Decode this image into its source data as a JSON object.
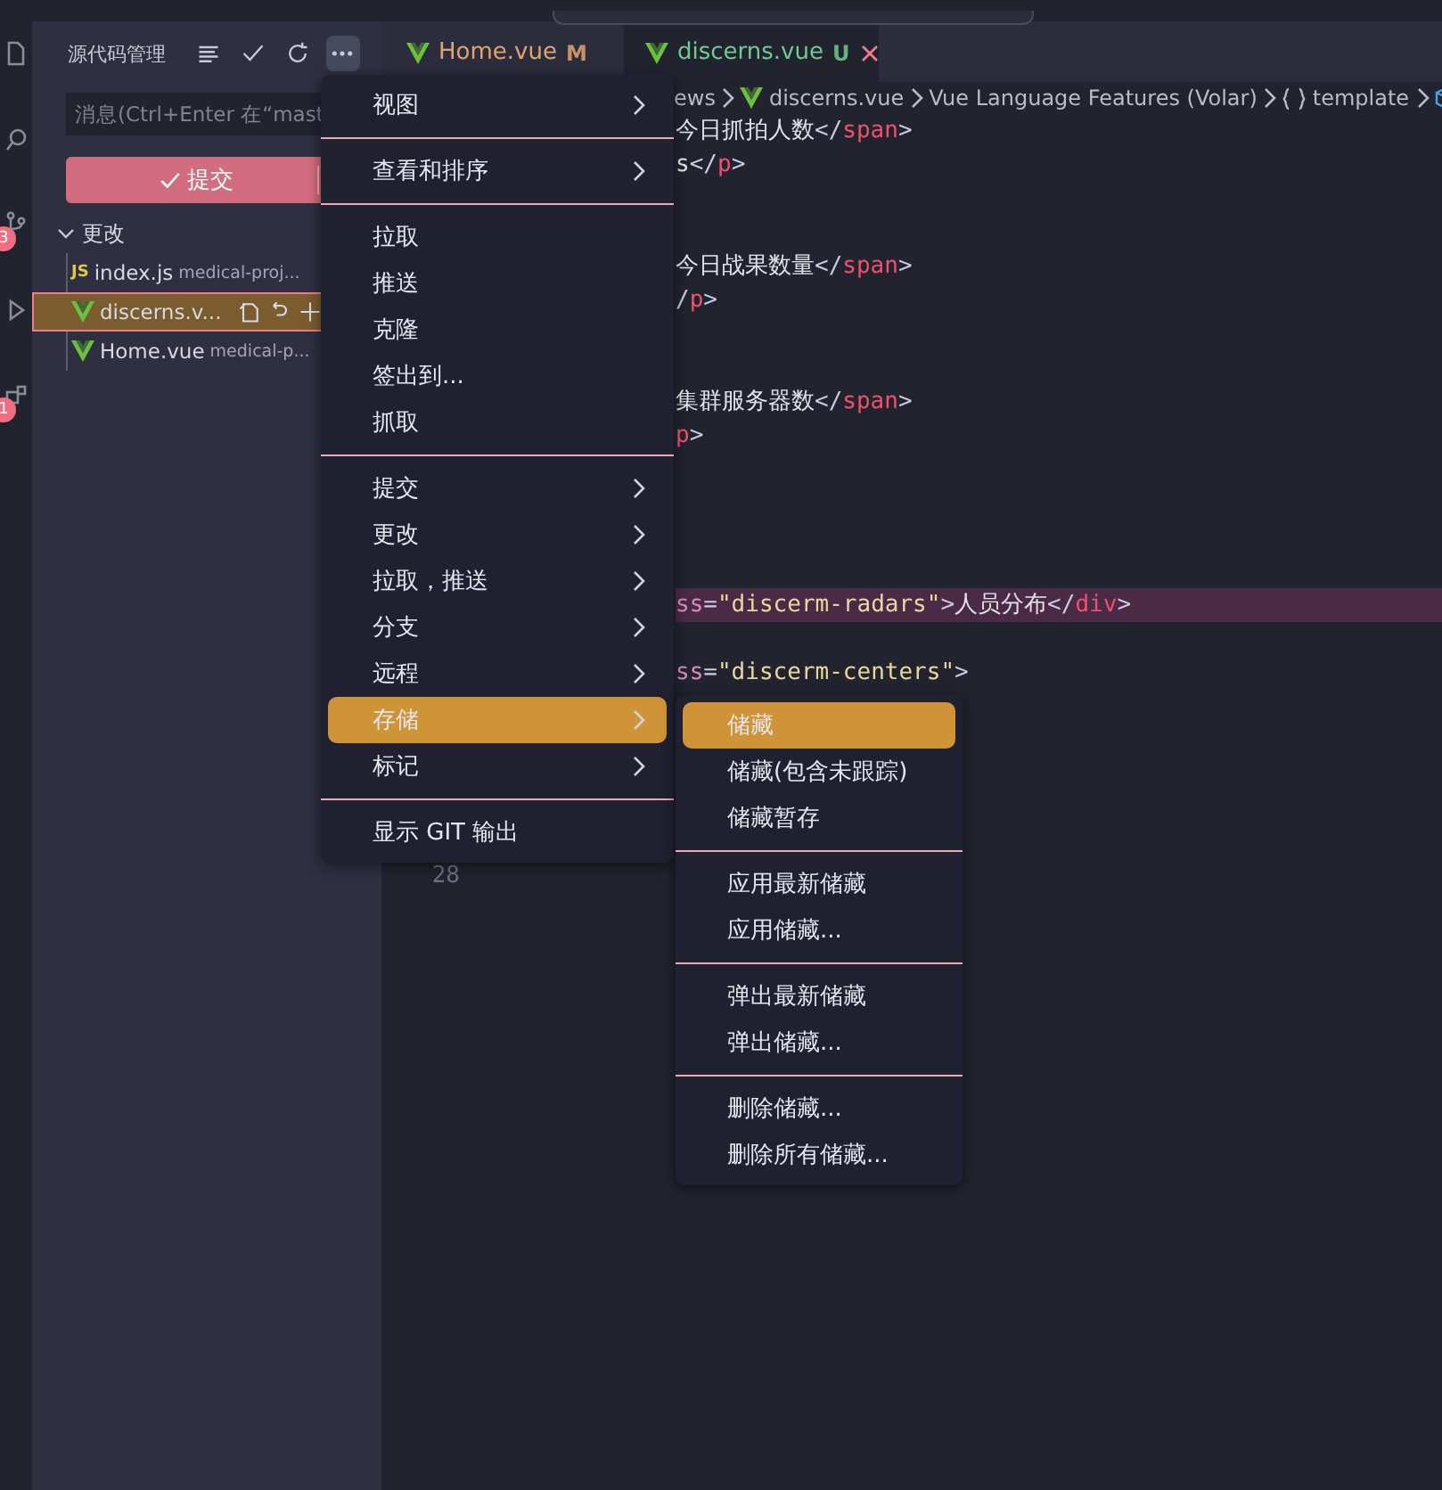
{
  "activity_bar": [
    {
      "kind": "files"
    },
    {
      "kind": "search"
    },
    {
      "kind": "branch",
      "badge": "3"
    },
    {
      "kind": "run"
    },
    {
      "kind": "extensions",
      "badge": "1"
    }
  ],
  "sidebar": {
    "title": "源代码管理",
    "toolbar": [
      {
        "kind": "list",
        "selected": false
      },
      {
        "kind": "check",
        "selected": false
      },
      {
        "kind": "refresh",
        "selected": false
      },
      {
        "kind": "more",
        "selected": true
      }
    ],
    "message_input": {
      "placeholder": "消息(Ctrl+Enter 在“mast"
    },
    "commit_button": {
      "label": "提交"
    },
    "changes": {
      "title": "更改",
      "expanded": true,
      "files": [
        {
          "kind": "js",
          "icon_label": "JS",
          "name": "index.js",
          "path": "medical-proj...",
          "selected": false
        },
        {
          "kind": "vue",
          "name": "discerns.v...",
          "selected": true
        },
        {
          "kind": "vue",
          "name": "Home.vue",
          "path": "medical-p...",
          "selected": false
        }
      ]
    }
  },
  "tabs": [
    {
      "name": "Home.vue",
      "status": "M",
      "color": "#e2a46e",
      "selected": false
    },
    {
      "name": "discerns.vue",
      "status": "U",
      "color": "#73c991",
      "selected": true
    }
  ],
  "breadcrumb": [
    {
      "kind": "plain",
      "label": "ews"
    },
    {
      "kind": "vue",
      "label": "discerns.vue"
    },
    {
      "kind": "plain",
      "label": "Vue Language Features (Volar)"
    },
    {
      "kind": "braces",
      "label": "template"
    }
  ],
  "code_rows": [
    {
      "kind": "code",
      "highlighted": false,
      "tokens": [
        {
          "text": "今日抓拍人数",
          "kind": "text"
        },
        {
          "text": "</",
          "kind": "punct"
        },
        {
          "text": "span",
          "kind": "tag"
        },
        {
          "text": ">",
          "kind": "punct"
        }
      ]
    },
    {
      "kind": "code",
      "highlighted": false,
      "tokens": [
        {
          "text": "s",
          "kind": "text"
        },
        {
          "text": "</",
          "kind": "punct"
        },
        {
          "text": "p",
          "kind": "tag"
        },
        {
          "text": ">",
          "kind": "punct"
        }
      ]
    },
    {
      "kind": "blank",
      "highlighted": false
    },
    {
      "kind": "blank",
      "highlighted": false
    },
    {
      "kind": "code",
      "highlighted": false,
      "tokens": [
        {
          "text": "今日战果数量",
          "kind": "text"
        },
        {
          "text": "</",
          "kind": "punct"
        },
        {
          "text": "span",
          "kind": "tag"
        },
        {
          "text": ">",
          "kind": "punct"
        }
      ]
    },
    {
      "kind": "code",
      "highlighted": false,
      "tokens": [
        {
          "text": "/",
          "kind": "punct"
        },
        {
          "text": "p",
          "kind": "tag"
        },
        {
          "text": ">",
          "kind": "punct"
        }
      ]
    },
    {
      "kind": "blank",
      "highlighted": false
    },
    {
      "kind": "blank",
      "highlighted": false
    },
    {
      "kind": "code",
      "highlighted": false,
      "tokens": [
        {
          "text": "集群服务器数",
          "kind": "text"
        },
        {
          "text": "</",
          "kind": "punct"
        },
        {
          "text": "span",
          "kind": "tag"
        },
        {
          "text": ">",
          "kind": "punct"
        }
      ]
    },
    {
      "kind": "code",
      "highlighted": false,
      "tokens": [
        {
          "text": "p",
          "kind": "tag"
        },
        {
          "text": ">",
          "kind": "punct"
        }
      ]
    },
    {
      "kind": "blank",
      "highlighted": false
    },
    {
      "kind": "blank",
      "highlighted": false
    },
    {
      "kind": "blank",
      "highlighted": false
    },
    {
      "kind": "blank",
      "highlighted": false
    },
    {
      "kind": "code",
      "highlighted": true,
      "tokens": [
        {
          "text": "ss",
          "kind": "attr"
        },
        {
          "text": "=",
          "kind": "punct"
        },
        {
          "text": "\"discerm-radars\"",
          "kind": "string"
        },
        {
          "text": ">",
          "kind": "punct"
        },
        {
          "text": "人员分布",
          "kind": "text"
        },
        {
          "text": "</",
          "kind": "punct"
        },
        {
          "text": "div",
          "kind": "tag"
        },
        {
          "text": ">",
          "kind": "punct"
        }
      ]
    },
    {
      "kind": "blank",
      "highlighted": false
    },
    {
      "kind": "code",
      "highlighted": false,
      "tokens": [
        {
          "text": "ss",
          "kind": "attr"
        },
        {
          "text": "=",
          "kind": "punct"
        },
        {
          "text": "\"discerm-centers\"",
          "kind": "string"
        },
        {
          "text": ">",
          "kind": "punct"
        }
      ]
    },
    {
      "kind": "blank",
      "highlighted": false
    },
    {
      "kind": "blank",
      "highlighted": false
    },
    {
      "kind": "blank",
      "highlighted": false
    },
    {
      "kind": "blank",
      "highlighted": false
    },
    {
      "kind": "blank",
      "highlighted": false
    },
    {
      "kind": "blank",
      "highlighted": false,
      "number": "28"
    }
  ],
  "menu": {
    "groups": [
      {
        "items": [
          {
            "label": "视图",
            "submenu": true,
            "selected": false
          }
        ]
      },
      {
        "items": [
          {
            "label": "查看和排序",
            "submenu": true,
            "selected": false
          }
        ]
      },
      {
        "items": [
          {
            "label": "拉取",
            "submenu": false,
            "selected": false
          },
          {
            "label": "推送",
            "submenu": false,
            "selected": false
          },
          {
            "label": "克隆",
            "submenu": false,
            "selected": false
          },
          {
            "label": "签出到...",
            "submenu": false,
            "selected": false
          },
          {
            "label": "抓取",
            "submenu": false,
            "selected": false
          }
        ]
      },
      {
        "items": [
          {
            "label": "提交",
            "submenu": true,
            "selected": false
          },
          {
            "label": "更改",
            "submenu": true,
            "selected": false
          },
          {
            "label": "拉取，推送",
            "submenu": true,
            "selected": false
          },
          {
            "label": "分支",
            "submenu": true,
            "selected": false
          },
          {
            "label": "远程",
            "submenu": true,
            "selected": false
          },
          {
            "label": "存储",
            "submenu": true,
            "selected": true
          },
          {
            "label": "标记",
            "submenu": true,
            "selected": false
          }
        ]
      },
      {
        "items": [
          {
            "label": "显示 GIT 输出",
            "submenu": false,
            "selected": false
          }
        ]
      }
    ]
  },
  "submenu": {
    "groups": [
      {
        "items": [
          {
            "label": "储藏",
            "submenu": false,
            "selected": true
          },
          {
            "label": "储藏(包含未跟踪)",
            "submenu": false,
            "selected": false
          },
          {
            "label": "储藏暂存",
            "submenu": false,
            "selected": false
          }
        ]
      },
      {
        "items": [
          {
            "label": "应用最新储藏",
            "submenu": false,
            "selected": false
          },
          {
            "label": "应用储藏...",
            "submenu": false,
            "selected": false
          }
        ]
      },
      {
        "items": [
          {
            "label": "弹出最新储藏",
            "submenu": false,
            "selected": false
          },
          {
            "label": "弹出储藏...",
            "submenu": false,
            "selected": false
          }
        ]
      },
      {
        "items": [
          {
            "label": "删除储藏...",
            "submenu": false,
            "selected": false
          },
          {
            "label": "删除所有储藏...",
            "submenu": false,
            "selected": false
          }
        ]
      }
    ]
  }
}
